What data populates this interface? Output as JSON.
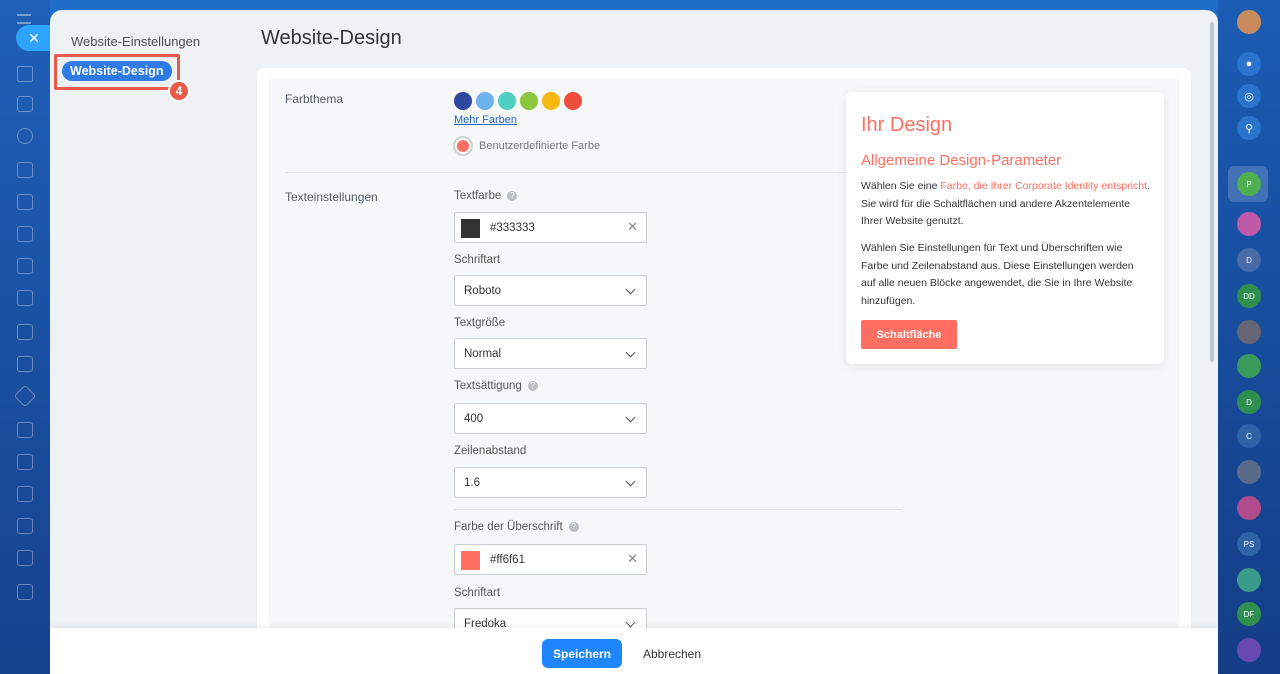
{
  "sidebar": {
    "title": "Website-Einstellungen",
    "active_item": "Website-Design",
    "step_badge": "4"
  },
  "page": {
    "title": "Website-Design"
  },
  "color_theme": {
    "label": "Farbthema",
    "colors": [
      "#2e48a0",
      "#6cb2ec",
      "#4fcfc3",
      "#8cc63f",
      "#f5b912",
      "#f04e3c"
    ],
    "more_colors": "Mehr Farben",
    "custom_color": "Benutzerdefinierte Farbe"
  },
  "text_settings": {
    "label": "Texteinstellungen",
    "text_color_label": "Textfarbe",
    "text_color_value": "#333333",
    "font_label": "Schriftart",
    "font_value": "Roboto",
    "size_label": "Textgröße",
    "size_value": "Normal",
    "weight_label": "Textsättigung",
    "weight_value": "400",
    "line_height_label": "Zeilenabstand",
    "line_height_value": "1.6",
    "heading_color_label": "Farbe der Überschrift",
    "heading_color_value": "#ff6f61",
    "heading_color_text": "#ff6f61",
    "heading_font_label": "Schriftart",
    "heading_font_value": "Fredoka"
  },
  "preview": {
    "title": "Ihr Design",
    "subtitle": "Allgemeine Design-Parameter",
    "p1_before": "Wählen Sie eine ",
    "p1_accent": "Farbe, die Ihrer Corporate Identity entspricht",
    "p1_after": ". Sie wird für die Schaltflächen und andere Akzentelemente Ihrer Website genutzt.",
    "p2": "Wählen Sie Einstellungen für Text und Überschriften wie Farbe und Zeilenabstand aus. Diese Einstellungen werden auf alle neuen Blöcke angewendet, die Sie in Ihre Website hinzufügen.",
    "button": "Schaltfläche"
  },
  "footer": {
    "save": "Speichern",
    "cancel": "Abbrechen"
  },
  "right_rail": {
    "avatars": [
      "P",
      "D",
      "DD",
      "D",
      "C",
      "PS",
      "DF"
    ]
  },
  "accent_color": "#ff6f61",
  "primary_color": "#1f86ff"
}
